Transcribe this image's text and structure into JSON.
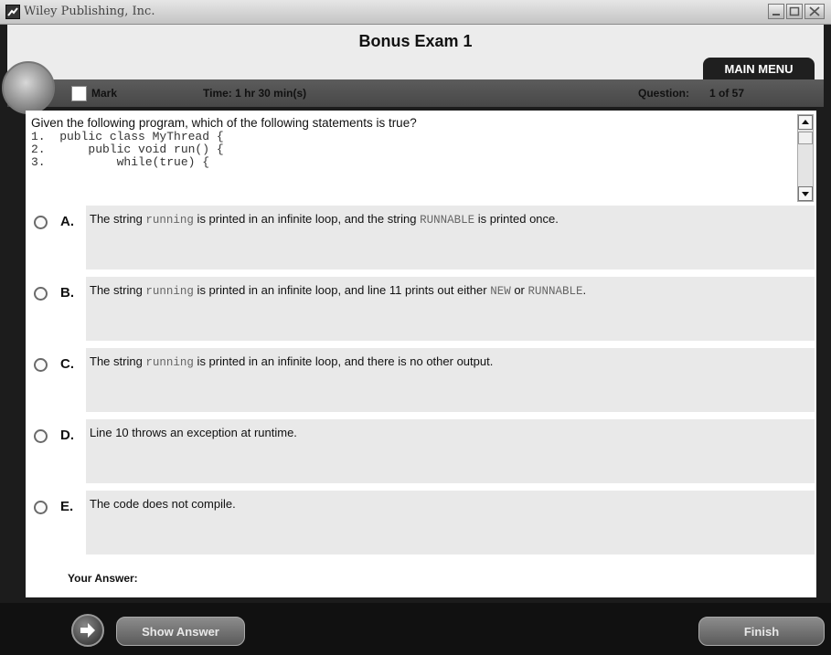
{
  "window": {
    "title": "Wiley Publishing, Inc."
  },
  "header": {
    "exam_title": "Bonus Exam 1",
    "main_menu_label": "MAIN MENU"
  },
  "status": {
    "mark_label": "Mark",
    "time_text": "Time: 1 hr 30 min(s)",
    "question_label": "Question:",
    "question_count": "1 of 57"
  },
  "question": {
    "text": "Given the following program, which of the following statements is true?",
    "code_lines": [
      "1.  public class MyThread {",
      "2.      public void run() {",
      "3.          while(true) {"
    ]
  },
  "choices": [
    {
      "letter": "A.",
      "parts": [
        {
          "t": "The string "
        },
        {
          "t": "running",
          "mono": true
        },
        {
          "t": " is printed in an infinite loop, and the string "
        },
        {
          "t": "RUNNABLE",
          "mono": true
        },
        {
          "t": " is printed once."
        }
      ]
    },
    {
      "letter": "B.",
      "parts": [
        {
          "t": "The string "
        },
        {
          "t": "running",
          "mono": true
        },
        {
          "t": " is printed in an infinite loop, and line 11 prints out either "
        },
        {
          "t": "NEW",
          "mono": true
        },
        {
          "t": " or "
        },
        {
          "t": "RUNNABLE",
          "mono": true
        },
        {
          "t": "."
        }
      ]
    },
    {
      "letter": "C.",
      "parts": [
        {
          "t": "The string "
        },
        {
          "t": "running",
          "mono": true
        },
        {
          "t": " is printed in an infinite loop, and there is no other output."
        }
      ]
    },
    {
      "letter": "D.",
      "parts": [
        {
          "t": "Line 10 throws an exception at runtime."
        }
      ]
    },
    {
      "letter": "E.",
      "parts": [
        {
          "t": "The code does not compile."
        }
      ]
    }
  ],
  "answer": {
    "label": "Your Answer:"
  },
  "footer": {
    "show_answer_label": "Show Answer",
    "finish_label": "Finish"
  },
  "icons": {
    "app": "app-logo-icon",
    "minimize": "minimize-icon",
    "maximize": "maximize-icon",
    "close": "close-icon",
    "next": "arrow-right-icon"
  }
}
